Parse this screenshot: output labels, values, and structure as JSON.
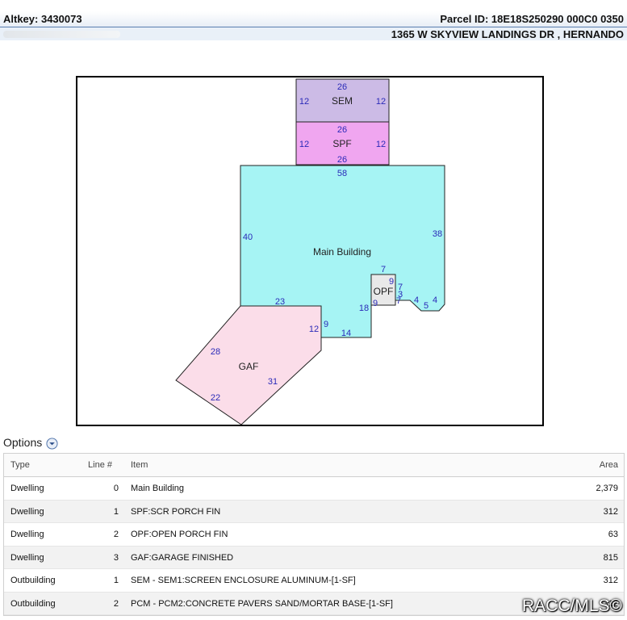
{
  "header": {
    "altkey": "Altkey: 3430073",
    "parcel_id": "Parcel ID: 18E18S250290 000C0 0350",
    "address": "1365 W SKYVIEW LANDINGS DR , HERNANDO"
  },
  "sketch": {
    "labels": {
      "sem": "SEM",
      "spf": "SPF",
      "main": "Main Building",
      "opf": "OPF",
      "gaf": "GAF"
    },
    "colors": {
      "sem": "#ccbbe6",
      "spf": "#f0a6f0",
      "main": "#a6f4f4",
      "opf": "#e9e9e9",
      "gaf": "#fbdde9",
      "dimension_text": "#2a2ab8"
    },
    "dimensions": {
      "sem_top": "26",
      "sem_left": "12",
      "sem_right": "12",
      "spf_top": "26",
      "spf_left": "12",
      "spf_right": "12",
      "spf_bottom": "26",
      "main_top": "58",
      "main_left": "40",
      "main_right": "38",
      "opf_top": "7",
      "opf_right_a": "9",
      "opf_right_b": "7",
      "opf_right_c": "3",
      "opf_right_d": "7",
      "notch_a": "4",
      "notch_b": "5",
      "notch_c": "4",
      "main_bottom_left": "23",
      "opf_left": "9",
      "main_inner": "18",
      "garage_side": "12",
      "garage_step": "9",
      "main_bottom": "14",
      "gaf_left": "28",
      "gaf_right": "31",
      "gaf_bottom": "22"
    }
  },
  "options": {
    "label": "Options",
    "icon": "chevron-down-circle-icon"
  },
  "table": {
    "headers": {
      "type": "Type",
      "line": "Line #",
      "item": "Item",
      "area": "Area"
    },
    "rows": [
      {
        "type": "Dwelling",
        "line": "0",
        "item": "Main Building",
        "area": "2,379"
      },
      {
        "type": "Dwelling",
        "line": "1",
        "item": "SPF:SCR PORCH FIN",
        "area": "312"
      },
      {
        "type": "Dwelling",
        "line": "2",
        "item": "OPF:OPEN PORCH FIN",
        "area": "63"
      },
      {
        "type": "Dwelling",
        "line": "3",
        "item": "GAF:GARAGE FINISHED",
        "area": "815"
      },
      {
        "type": "Outbuilding",
        "line": "1",
        "item": "SEM - SEM1:SCREEN ENCLOSURE ALUMINUM-[1-SF]",
        "area": "312"
      },
      {
        "type": "Outbuilding",
        "line": "2",
        "item": "PCM - PCM2:CONCRETE PAVERS SAND/MORTAR BASE-[1-SF]",
        "area": "312"
      }
    ]
  },
  "watermark": "RACC/MLS©"
}
